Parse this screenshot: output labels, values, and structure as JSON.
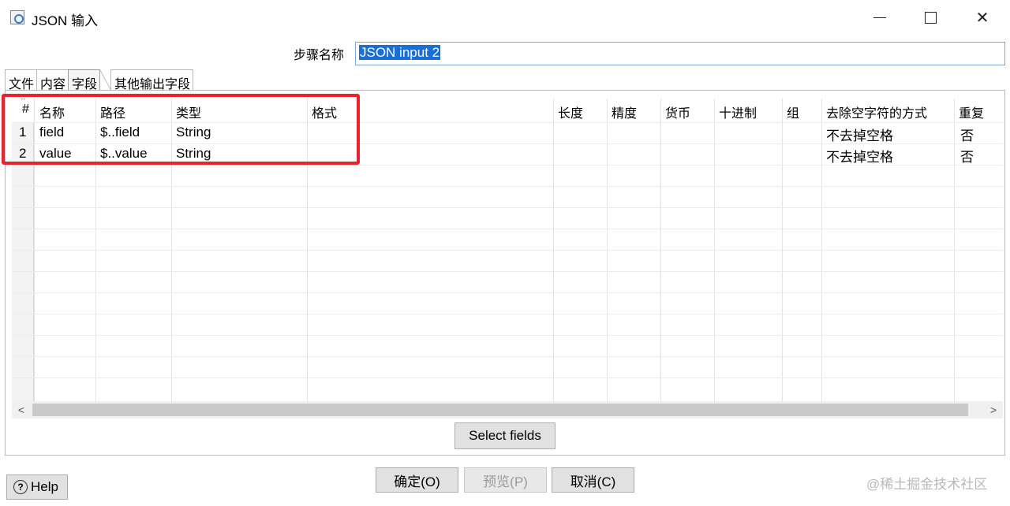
{
  "window": {
    "title": "JSON 输入",
    "minimize_icon": "minimize-icon",
    "maximize_icon": "maximize-icon",
    "close_icon": "close-icon",
    "close_glyph": "✕"
  },
  "step": {
    "label": "步骤名称",
    "value": "JSON input 2"
  },
  "tabs": [
    {
      "label": "文件",
      "active": false
    },
    {
      "label": "内容",
      "active": false
    },
    {
      "label": "字段",
      "active": true
    },
    {
      "label": "其他输出字段",
      "active": false
    }
  ],
  "table": {
    "headers": [
      "#",
      "名称",
      "路径",
      "类型",
      "格式",
      "长度",
      "精度",
      "货币",
      "十进制",
      "组",
      "去除空字符的方式",
      "重复"
    ],
    "rows": [
      [
        "1",
        "field",
        "$..field",
        "String",
        "",
        "",
        "",
        "",
        "",
        "",
        "不去掉空格",
        "否"
      ],
      [
        "2",
        "value",
        "$..value",
        "String",
        "",
        "",
        "",
        "",
        "",
        "",
        "不去掉空格",
        "否"
      ]
    ],
    "highlight_color": "#e8232e"
  },
  "buttons": {
    "select_fields": "Select fields",
    "ok": "确定(O)",
    "preview": "预览(P)",
    "cancel": "取消(C)",
    "help": "Help",
    "help_glyph": "?"
  },
  "scrollbar": {
    "left_arrow": "<",
    "right_arrow": ">"
  },
  "watermark": "@稀土掘金技术社区"
}
